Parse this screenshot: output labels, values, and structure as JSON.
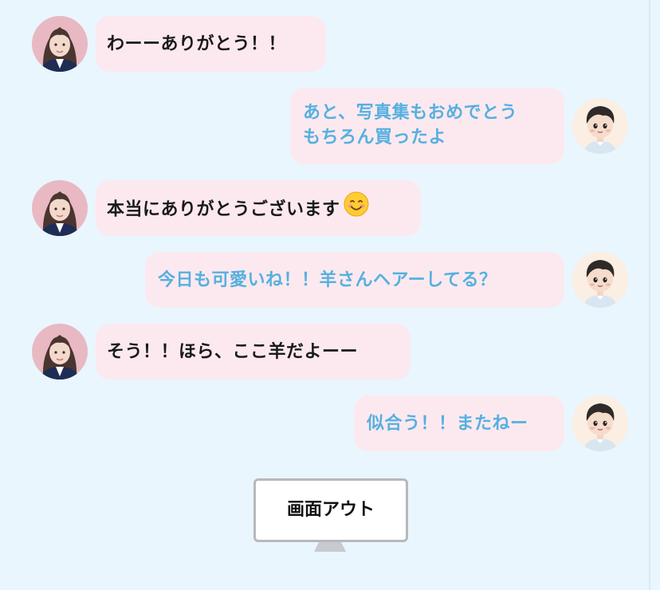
{
  "messages": [
    {
      "side": "left",
      "speaker": "idol",
      "lines": [
        "わーーありがとう！！"
      ]
    },
    {
      "side": "right",
      "speaker": "fan",
      "lines": [
        "あと、写真集もおめでとう",
        "もちろん買ったよ"
      ]
    },
    {
      "side": "left",
      "speaker": "idol",
      "lines": [
        "本当にありがとうございます"
      ],
      "emoji": "smiling-face-icon"
    },
    {
      "side": "right",
      "speaker": "fan",
      "lines": [
        "今日も可愛いね！！羊さんヘアーしてる？"
      ]
    },
    {
      "side": "left",
      "speaker": "idol",
      "lines": [
        "そう！！ほら、ここ羊だよーー"
      ]
    },
    {
      "side": "right",
      "speaker": "fan",
      "lines": [
        "似合う！！またねー"
      ]
    }
  ],
  "screen_out_button": {
    "label": "画面アウト"
  },
  "colors": {
    "background": "#e9f6fd",
    "bubble": "#fce9ef",
    "idol_text": "#1a1a1a",
    "fan_text": "#56b0e0",
    "monitor_border": "#b8b8bc"
  }
}
